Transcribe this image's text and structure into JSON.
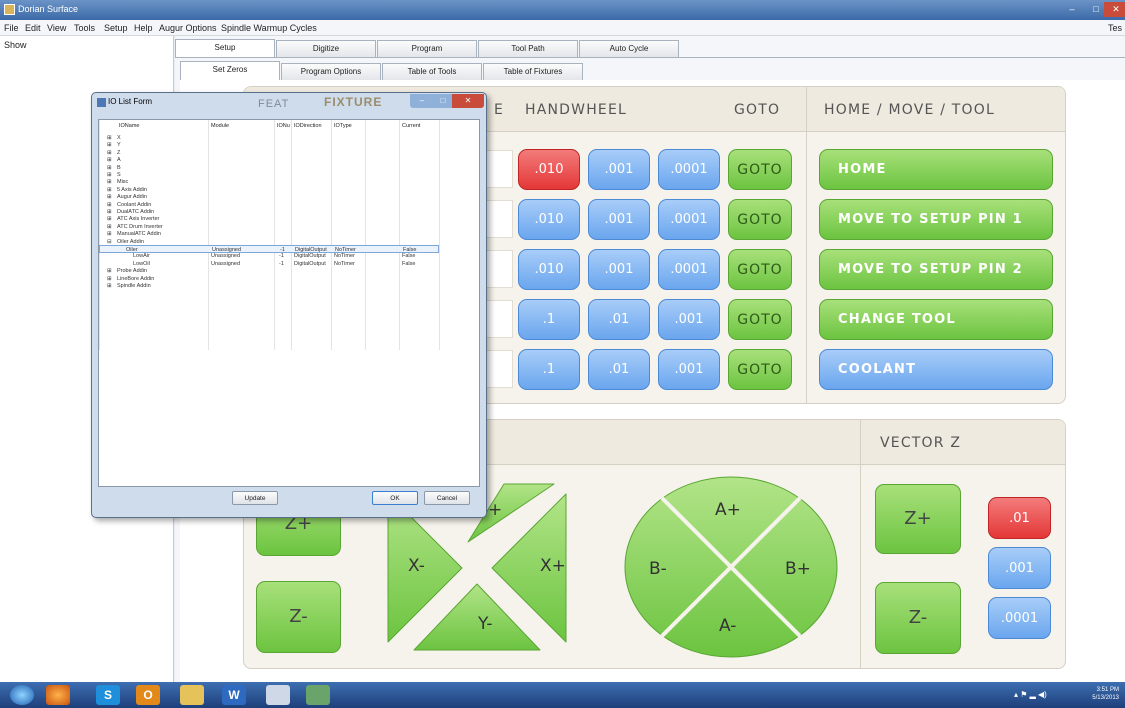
{
  "window": {
    "title": "Dorian Surface"
  },
  "menu": [
    "File",
    "Edit",
    "View",
    "Tools",
    "Setup",
    "Help",
    "Augur Options",
    "Spindle Warmup Cycles"
  ],
  "menu_right": "Tes",
  "left_pane": {
    "label": "Show"
  },
  "tabs_top": [
    "Setup",
    "Digitize",
    "Program",
    "Tool Path",
    "Auto Cycle"
  ],
  "tabs_sub": [
    "Set Zeros",
    "Program Options",
    "Table of Tools",
    "Table of Fixtures"
  ],
  "handwheel": {
    "title": "HANDWHEEL",
    "goto_title": "GOTO",
    "rows": [
      {
        "a": ".010",
        "b": ".001",
        "c": ".0001",
        "goto": "GOTO"
      },
      {
        "a": ".010",
        "b": ".001",
        "c": ".0001",
        "goto": "GOTO"
      },
      {
        "a": ".010",
        "b": ".001",
        "c": ".0001",
        "goto": "GOTO"
      },
      {
        "a": ".1",
        "b": ".01",
        "c": ".001",
        "goto": "GOTO"
      },
      {
        "a": ".1",
        "b": ".01",
        "c": ".001",
        "goto": "GOTO"
      }
    ],
    "partial_title": "E"
  },
  "home_move_tool": {
    "title": "HOME / MOVE / TOOL",
    "buttons": [
      "HOME",
      "MOVE TO SETUP PIN 1",
      "MOVE TO SETUP PIN 2",
      "CHANGE TOOL",
      "COOLANT"
    ]
  },
  "jog": {
    "z_plus": "Z+",
    "z_minus": "Z-",
    "x_minus": "X-",
    "x_plus": "X+",
    "y_minus": "Y-",
    "y_plus": "+",
    "a_plus": "A+",
    "a_minus": "A-",
    "b_minus": "B-",
    "b_plus": "B+"
  },
  "vector_z": {
    "title": "VECTOR Z",
    "z_plus": "Z+",
    "z_minus": "Z-",
    "increments": [
      ".01",
      ".001",
      ".0001"
    ]
  },
  "dialog": {
    "title": "IO List Form",
    "behind_labels": [
      "FEAT",
      "FIXTURE"
    ],
    "columns": [
      "IOName",
      "Module",
      "IONu",
      "IODirection",
      "IOType",
      "Current"
    ],
    "rows": [
      {
        "name": "X",
        "indent": 1,
        "exp": "+"
      },
      {
        "name": "Y",
        "indent": 1,
        "exp": "+"
      },
      {
        "name": "Z",
        "indent": 1,
        "exp": "+"
      },
      {
        "name": "A",
        "indent": 1,
        "exp": "+"
      },
      {
        "name": "B",
        "indent": 1,
        "exp": "+"
      },
      {
        "name": "S",
        "indent": 1,
        "exp": "+"
      },
      {
        "name": "Misc",
        "indent": 1,
        "exp": "+"
      },
      {
        "name": "5 Axis Addin",
        "indent": 1,
        "exp": "+"
      },
      {
        "name": "Augur Addin",
        "indent": 1,
        "exp": "+"
      },
      {
        "name": "Coolant Addin",
        "indent": 1,
        "exp": "+"
      },
      {
        "name": "DualATC Addin",
        "indent": 1,
        "exp": "+"
      },
      {
        "name": "ATC Axis Inverter",
        "indent": 1,
        "exp": "+"
      },
      {
        "name": "ATC Drum Inverter",
        "indent": 1,
        "exp": "+"
      },
      {
        "name": "ManualATC Addin",
        "indent": 1,
        "exp": "+"
      },
      {
        "name": "Oiler Addin",
        "indent": 1,
        "exp": "-"
      },
      {
        "name": "Oiler",
        "indent": 2,
        "exp": "",
        "module": "Unassigned",
        "ionum": "-1",
        "dir": "DigitalOutput",
        "type": "NoTimer",
        "current": "False",
        "selected": true
      },
      {
        "name": "LowAir",
        "indent": 3,
        "exp": "",
        "module": "Unassigned",
        "ionum": "-1",
        "dir": "DigitalOutput",
        "type": "NoTimer",
        "current": "False"
      },
      {
        "name": "LowOil",
        "indent": 3,
        "exp": "",
        "module": "Unassigned",
        "ionum": "-1",
        "dir": "DigitalOutput",
        "type": "NoTimer",
        "current": "False"
      },
      {
        "name": "Probe Addin",
        "indent": 1,
        "exp": "+"
      },
      {
        "name": "LineBore Addin",
        "indent": 1,
        "exp": "+"
      },
      {
        "name": "Spindle Addin",
        "indent": 1,
        "exp": "+"
      }
    ],
    "update_label": "Update",
    "ok_label": "OK",
    "cancel_label": "Cancel"
  },
  "taskbar": {
    "icons": [
      "start-orb",
      "firefox",
      "skype",
      "outlook",
      "explorer",
      "word",
      "notepad",
      "app"
    ],
    "time": "3:51 PM",
    "date": "5/13/2013"
  },
  "colors": {
    "green": "#6cc440",
    "blue": "#6aa6ee",
    "red": "#e43737"
  }
}
